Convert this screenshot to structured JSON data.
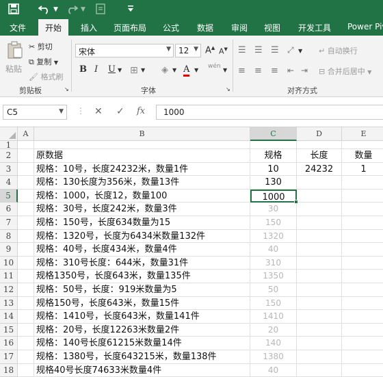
{
  "quick_access": {
    "save_icon": "save-icon",
    "undo_icon": "undo-icon",
    "redo_icon": "redo-icon",
    "touch_icon": "touch-mode-icon",
    "customize_icon": "customize-icon"
  },
  "tabs": [
    "文件",
    "开始",
    "插入",
    "页面布局",
    "公式",
    "数据",
    "审阅",
    "视图",
    "开发工具",
    "Power Piv"
  ],
  "active_tab": "开始",
  "ribbon": {
    "clipboard": {
      "paste": "粘贴",
      "cut": "剪切",
      "copy": "复制",
      "format_painter": "格式刷",
      "group_label": "剪贴板"
    },
    "font": {
      "name": "宋体",
      "size": "12",
      "grow": "A",
      "shrink": "A",
      "bold": "B",
      "italic": "I",
      "underline": "U",
      "font_color": "A",
      "phonetic": "wén",
      "group_label": "字体"
    },
    "alignment": {
      "wrap_text": "自动换行",
      "merge_center": "合并后居中",
      "group_label": "对齐方式"
    }
  },
  "formula_bar": {
    "name_box": "C5",
    "cancel": "✕",
    "enter": "✓",
    "fx": "fx",
    "value": "1000"
  },
  "columns": [
    "A",
    "B",
    "C",
    "D",
    "E"
  ],
  "rows": [
    {
      "num": "1",
      "B": "",
      "C": "",
      "D": "",
      "E": ""
    },
    {
      "num": "2",
      "B": "原数据",
      "C": "规格",
      "D": "长度",
      "E": "数量"
    },
    {
      "num": "3",
      "B": "规格：10号，长度24232米，数量1件",
      "C": "10",
      "D": "24232",
      "E": "1"
    },
    {
      "num": "4",
      "B": "规格：130长度为356米，数量13件",
      "C": "130",
      "D": "",
      "E": ""
    },
    {
      "num": "5",
      "B": "规格：1000，长度12，数量100",
      "C": "1000",
      "D": "",
      "E": ""
    },
    {
      "num": "6",
      "B": "规格：30号，长度242米，数量3件",
      "C": "30",
      "D": "",
      "E": ""
    },
    {
      "num": "7",
      "B": "规格：150号，长度634数量为15",
      "C": "150",
      "D": "",
      "E": ""
    },
    {
      "num": "8",
      "B": "规格：1320号，长度为6434米数量132件",
      "C": "1320",
      "D": "",
      "E": ""
    },
    {
      "num": "9",
      "B": "规格：40号，长度434米，数量4件",
      "C": "40",
      "D": "",
      "E": ""
    },
    {
      "num": "10",
      "B": "规格：310号长度：644米，数量31件",
      "C": "310",
      "D": "",
      "E": ""
    },
    {
      "num": "11",
      "B": "规格1350号，长度643米，数量135件",
      "C": "1350",
      "D": "",
      "E": ""
    },
    {
      "num": "12",
      "B": "规格：50号，长度：919米数量为5",
      "C": "50",
      "D": "",
      "E": ""
    },
    {
      "num": "13",
      "B": "规格150号，长度643米，数量15件",
      "C": "150",
      "D": "",
      "E": ""
    },
    {
      "num": "14",
      "B": "规格：1410号，长度643米，数量141件",
      "C": "1410",
      "D": "",
      "E": ""
    },
    {
      "num": "15",
      "B": "规格：20号，长度12263米数量2件",
      "C": "20",
      "D": "",
      "E": ""
    },
    {
      "num": "16",
      "B": "规格：140号长度61215米数量14件",
      "C": "140",
      "D": "",
      "E": ""
    },
    {
      "num": "17",
      "B": "规格：1380号，长度643215米，数量138件",
      "C": "1380",
      "D": "",
      "E": ""
    },
    {
      "num": "18",
      "B": "规格40号长度74633米数量4件",
      "C": "40",
      "D": "",
      "E": ""
    }
  ],
  "active_cell": "C5",
  "colors": {
    "excel_green": "#217346",
    "ghost_text": "#b8b8b8"
  }
}
